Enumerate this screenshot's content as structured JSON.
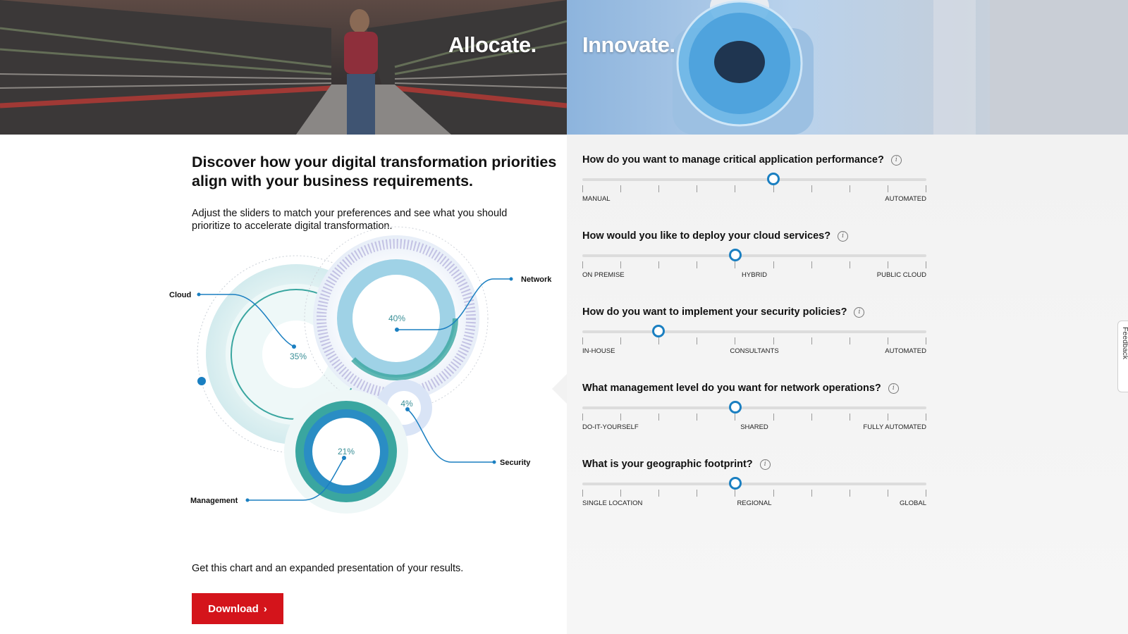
{
  "hero": {
    "left_word": "Allocate.",
    "right_word": "Innovate."
  },
  "intro": {
    "headline": "Discover how your digital transformation priorities align with your business requirements.",
    "subtext": "Adjust the sliders to match your preferences and see what you should prioritize to accelerate digital transformation."
  },
  "chart_data": {
    "type": "other",
    "segments": [
      {
        "name": "Cloud",
        "percent": 35,
        "percent_label": "35%"
      },
      {
        "name": "Network",
        "percent": 40,
        "percent_label": "40%"
      },
      {
        "name": "Security",
        "percent": 4,
        "percent_label": "4%"
      },
      {
        "name": "Management",
        "percent": 21,
        "percent_label": "21%"
      }
    ]
  },
  "cta": {
    "text": "Get this chart and an expanded presentation of your results.",
    "download_label": "Download"
  },
  "questions": [
    {
      "title": "How do you want to manage critical application performance?",
      "info_icon": "info-icon",
      "position": 0.556,
      "left_label": "Manual",
      "center_label": "",
      "right_label": "Automated"
    },
    {
      "title": "How would you like to deploy your cloud services?",
      "info_icon": "info-icon",
      "position": 0.444,
      "left_label": "On Premise",
      "center_label": "Hybrid",
      "right_label": "Public Cloud"
    },
    {
      "title": "How do you want to implement your security policies?",
      "info_icon": "info-icon",
      "position": 0.222,
      "left_label": "In-House",
      "center_label": "Consultants",
      "right_label": "Automated"
    },
    {
      "title": "What management level do you want for network operations?",
      "info_icon": "info-icon",
      "position": 0.444,
      "left_label": "Do-It-Yourself",
      "center_label": "Shared",
      "right_label": "Fully Automated"
    },
    {
      "title": "What is your geographic footprint?",
      "info_icon": "info-icon",
      "position": 0.444,
      "left_label": "Single Location",
      "center_label": "Regional",
      "right_label": "Global"
    }
  ],
  "feedback": {
    "label": "Feedback"
  },
  "colors": {
    "accent_blue": "#1a7fc1",
    "download_red": "#d4141b",
    "teal": "#3aa6a0",
    "panel_bg": "#f2f2f2"
  }
}
